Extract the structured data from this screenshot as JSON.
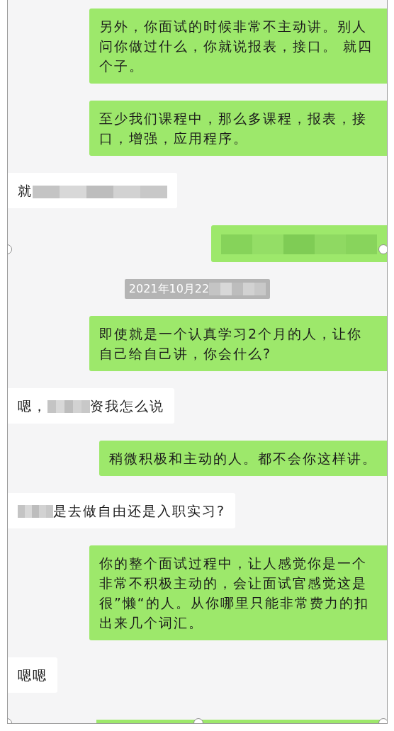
{
  "messages": [
    {
      "sent": true,
      "kind": "text",
      "parts": [
        {
          "kind": "text",
          "text": "另外，你面试的时候非常不主动讲。别人问你做过什么，你就说报表，接口。 就四个子。"
        }
      ]
    },
    {
      "sent": true,
      "kind": "text",
      "parts": [
        {
          "kind": "text",
          "text": "至少我们课程中，那么多课程，报表，接口，增强，应用程序。"
        }
      ]
    },
    {
      "sent": false,
      "kind": "text",
      "parts": [
        {
          "kind": "text",
          "text": "就"
        },
        {
          "kind": "blur"
        }
      ]
    },
    {
      "sent": true,
      "kind": "text",
      "parts": [
        {
          "kind": "blur"
        }
      ]
    },
    {
      "kind": "time",
      "parts": [
        {
          "kind": "text",
          "text": "2021年10月22"
        },
        {
          "kind": "blur"
        }
      ]
    },
    {
      "sent": true,
      "kind": "text",
      "parts": [
        {
          "kind": "text",
          "text": "即使就是一个认真学习2个月的人，让你自己给自己讲，你会什么?"
        }
      ]
    },
    {
      "sent": false,
      "kind": "text",
      "parts": [
        {
          "kind": "text",
          "text": "嗯，"
        },
        {
          "kind": "blur"
        },
        {
          "kind": "text",
          "text": "资我怎么说"
        }
      ]
    },
    {
      "sent": true,
      "kind": "text",
      "parts": [
        {
          "kind": "text",
          "text": "稍微积极和主动的人。都不会你这样讲。"
        }
      ]
    },
    {
      "sent": false,
      "kind": "text",
      "parts": [
        {
          "kind": "blur"
        },
        {
          "kind": "text",
          "text": "是去做自由还是入职实习?"
        }
      ]
    },
    {
      "sent": true,
      "kind": "text",
      "parts": [
        {
          "kind": "text",
          "text": "你的整个面试过程中，让人感觉你是一个非常不积极主动的，会让面试官感觉这是很”懒“的人。从你哪里只能非常费力的扣出来几个词汇。"
        }
      ]
    },
    {
      "sent": false,
      "kind": "text",
      "parts": [
        {
          "kind": "text",
          "text": "嗯嗯"
        }
      ]
    },
    {
      "sent": true,
      "kind": "clipped"
    }
  ]
}
